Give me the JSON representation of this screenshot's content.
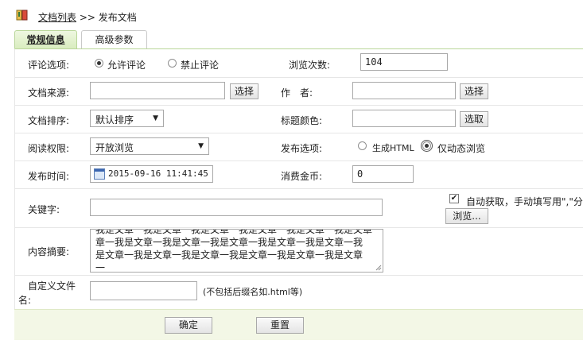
{
  "breadcrumb": {
    "list_link": "文档列表",
    "sep": ">>",
    "current": "发布文档"
  },
  "tabs": [
    {
      "label": "常规信息"
    },
    {
      "label": "高级参数"
    }
  ],
  "form": {
    "comment_label": "评论选项:",
    "comment_allow": "允许评论",
    "comment_deny": "禁止评论",
    "views_label": "浏览次数:",
    "views_value": "104",
    "source_label": "文档来源:",
    "source_value": "",
    "select_btn": "选择",
    "author_label": "作　者:",
    "author_value": "",
    "author_select_btn": "选择",
    "sort_label": "文档排序:",
    "sort_value": "默认排序",
    "title_color_label": "标题颜色:",
    "title_color_value": "",
    "pick_btn": "选取",
    "read_label": "阅读权限:",
    "read_value": "开放浏览",
    "publish_label": "发布选项:",
    "publish_html": "生成HTML",
    "publish_dynamic": "仅动态浏览",
    "time_label": "发布时间:",
    "time_value": "2015-09-16 11:41:45",
    "coin_label": "消费金币:",
    "coin_value": "0",
    "keywords_label": "关键字:",
    "keywords_value": "",
    "auto_fetch": "自动获取，手动填写用\",\"分",
    "browse_btn": "浏览...",
    "summary_label": "内容摘要:",
    "summary_lines": [
      "我是文章一我是文章一我是文章一我是文章一我是文章一我是文章",
      "章一我是文章一我是文章一我是文章一我是文章一我是文章一我",
      "是文章一我是文章一我是文章一我是文章一我是文章一我是文章",
      "一"
    ],
    "custom_file_label_1": "自定义文件",
    "custom_file_label_2": "名:",
    "custom_file_value": "",
    "custom_file_hint": "(不包括后缀名如.html等)"
  },
  "footer": {
    "ok": "确定",
    "reset": "重置"
  },
  "colors": {
    "tab_border": "#b9d69a",
    "footer_bg": "#f3f7e6"
  }
}
